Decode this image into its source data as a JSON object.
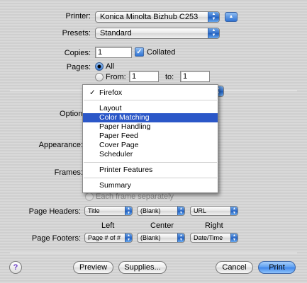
{
  "printer": {
    "label": "Printer:",
    "value": "Konica Minolta Bizhub C253"
  },
  "presets": {
    "label": "Presets:",
    "value": "Standard"
  },
  "copies": {
    "label": "Copies:",
    "value": "1",
    "collated_label": "Collated"
  },
  "pages": {
    "label": "Pages:",
    "all_label": "All",
    "from_label": "From:",
    "from_value": "1",
    "to_label": "to:",
    "to_value": "1"
  },
  "menu": {
    "items": [
      "Firefox",
      "Layout",
      "Color Matching",
      "Paper Handling",
      "Paper Feed",
      "Cover Page",
      "Scheduler",
      "Printer Features",
      "Summary"
    ],
    "checked_item": "Firefox",
    "highlighted_item": "Color Matching"
  },
  "options": {
    "options_label": "Options:",
    "appearance_label": "Appearance:",
    "frames_label": "Frames:",
    "each_frame_label": "Each frame separately"
  },
  "headers": {
    "label": "Page Headers:",
    "left": "Title",
    "center": "(Blank)",
    "right": "URL"
  },
  "positions": {
    "left": "Left",
    "center": "Center",
    "right": "Right"
  },
  "footers": {
    "label": "Page Footers:",
    "left": "Page # of #",
    "center": "(Blank)",
    "right": "Date/Time"
  },
  "buttons": {
    "help": "?",
    "preview": "Preview",
    "supplies": "Supplies...",
    "cancel": "Cancel",
    "print": "Print"
  },
  "colors": {
    "accent": "#2b57c8",
    "window_bg": "#d2d2d2"
  }
}
